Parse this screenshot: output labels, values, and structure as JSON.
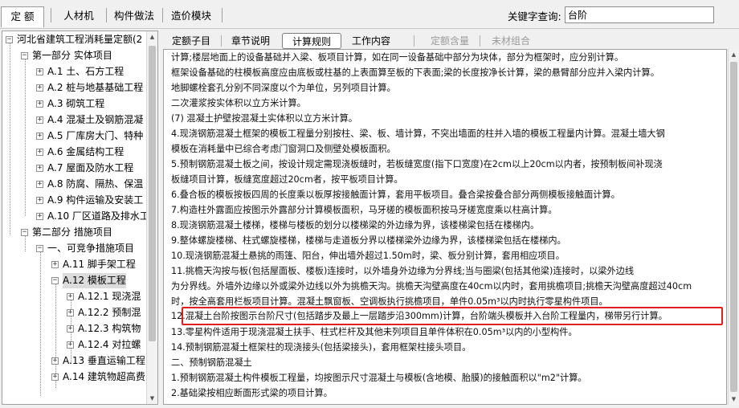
{
  "toolbar": {
    "tabs": [
      "定 额",
      "人材机",
      "构件做法",
      "造价模块"
    ],
    "search_label": "关键字查询:",
    "search_value": "台阶"
  },
  "tree": {
    "root": "河北省建筑工程消耗量定额(2",
    "part1": "第一部分 实体项目",
    "part1_items": [
      "A.1 土、石方工程",
      "A.2 桩与地基基础工程",
      "A.3 砌筑工程",
      "A.4 混凝土及钢筋混凝",
      "A.5 厂库房大门、特种",
      "A.6 金属结构工程",
      "A.7 屋面及防水工程",
      "A.8 防腐、隔热、保温",
      "A.9 构件运输及安装工",
      "A.10 厂区道路及排水工"
    ],
    "part2": "第二部分 措施项目",
    "part2_group": "一、可竞争措施项目",
    "a11": "A.11 脚手架工程",
    "a12": "A.12 模板工程",
    "a12_children": [
      "A.12.1 现浇混",
      "A.12.2 预制混",
      "A.12.3 构筑物",
      "A.12.4 对拉螺"
    ],
    "a13": "A.13 垂直运输工程",
    "a14": "A.14 建筑物超高费"
  },
  "right_tabs": {
    "items": [
      "定额子目",
      "章节说明",
      "计算规则",
      "工作内容",
      "定额含量",
      "未材组合"
    ],
    "active": "计算规则"
  },
  "content_lines": [
    "计算;楼层地面上的设备基础并入梁、板项目计算，如在同一设备基础中部分为块体，部分为框架时，应分别计算。",
    "     框架设备基础的柱模板高度应由底板或柱基的上表面算至板的下表面;梁的长度按净长计算，梁的悬臂部分应并入梁内计算。",
    "     地脚螺栓套孔分别不同深度以个为单位，另列项目计算。",
    "     二次灌浆按实体积以立方米计算。",
    "     (7) 混凝土护壁按混凝土实体积以立方米计算。",
    "     4.现浇钢筋混凝土框架的模板工程量分别按柱、梁、板、墙计算，不突出墙面的柱并入墙的模板工程量内计算。混凝土墙大钢",
    "模板在消耗量中已综合考虑门窗洞口及侧壁处模板面积。",
    "     5.预制钢筋混凝土板之间，按设计规定需现浇板缝时，若板缝宽度(指下口宽度)在2cm以上20cm以内者，按预制板间补现浇",
    "板缝项目计算，板缝宽度超过20cm者，按平板项目计算。",
    "     6.叠合板的模板按板四周的长度乘以板厚按接触面计算，套用平板项目。叠合梁按叠合部分两侧模板接触面计算。",
    "     7.构造柱外露面应按图示外露部分计算模板面积，马牙槎的模板面积按马牙槎宽度乘以柱高计算。",
    "     8.现浇钢筋混凝土楼梯，楼梯与楼板的划分以楼梯梁的外边缘为界，该楼梯梁包括在楼梯内。",
    "     9.整体螺旋楼梯、柱式螺旋楼梯，楼梯与走道板分界以楼梯梁外边缘为界，该楼梯梁包括在楼梯内。",
    "     10.现浇钢筋混凝土悬挑的雨篷、阳台，伸出墙外超过1.50m时，梁、板分别计算，套用相应项目。",
    "     11.挑檐天沟按与板(包括屋面板、楼板)连接时，以外墙身外边缘为分界线;当与圈梁(包括其他梁)连接时，以梁外边线",
    "为分界线。外墙外边缘以外或梁外边线以外为挑檐天沟。挑檐天沟壁高度在40cm以内时，套用挑檐项目;挑檐天沟壁高度超过40cm",
    "时，按全高套用栏板项目计算。混凝土飘窗板、空调板执行挑檐项目，单件0.05m³以内时执行零星构件项目。",
    "     12.混凝土台阶按图示台阶尺寸(包括踏步及最上一层踏步沿300mm)计算，台阶端头模板并入台阶工程量内，梯带另行计算。",
    "     13.零星构件适用于现浇混凝土扶手、柱式栏杆及其他未列项目且单件体积在0.05m³以内的小型构件。",
    "     14.预制钢筋混凝土框架柱的现浇接头(包括梁接头)，套用框架柱接头项目。",
    "     二、预制钢筋混凝土",
    "     1.预制钢筋混凝土构件模板工程量，均按图示尺寸混凝土与模板(含地模、胎膜)的接触面积以\"m2\"计算。",
    "     2.基础梁按相应断面形式梁的项目计算。"
  ]
}
